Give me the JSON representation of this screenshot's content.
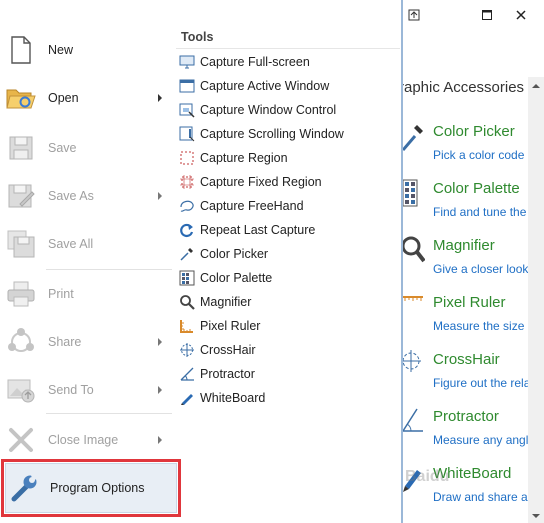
{
  "file_menu": {
    "items": [
      {
        "label": "New",
        "icon": "new-document-icon",
        "enabled": true,
        "submenu": false
      },
      {
        "label": "Open",
        "icon": "open-folder-icon",
        "enabled": true,
        "submenu": true
      },
      {
        "label": "Save",
        "icon": "save-icon",
        "enabled": false,
        "submenu": false
      },
      {
        "label": "Save As",
        "icon": "save-as-icon",
        "enabled": false,
        "submenu": true
      },
      {
        "label": "Save All",
        "icon": "save-all-icon",
        "enabled": false,
        "submenu": false
      },
      {
        "label": "Print",
        "icon": "printer-icon",
        "enabled": false,
        "submenu": false
      },
      {
        "label": "Share",
        "icon": "share-icon",
        "enabled": false,
        "submenu": true
      },
      {
        "label": "Send To",
        "icon": "send-to-icon",
        "enabled": false,
        "submenu": true
      },
      {
        "label": "Close Image",
        "icon": "close-icon",
        "enabled": false,
        "submenu": true
      }
    ],
    "program_options": {
      "label": "Program Options",
      "icon": "wrench-icon",
      "enabled": true
    }
  },
  "tools": {
    "header": "Tools",
    "items": [
      {
        "label": "Capture Full-screen",
        "icon": "monitor-icon"
      },
      {
        "label": "Capture Active Window",
        "icon": "window-icon"
      },
      {
        "label": "Capture Window Control",
        "icon": "window-control-icon"
      },
      {
        "label": "Capture Scrolling Window",
        "icon": "scrolling-window-icon"
      },
      {
        "label": "Capture Region",
        "icon": "region-icon"
      },
      {
        "label": "Capture Fixed Region",
        "icon": "fixed-region-icon"
      },
      {
        "label": "Capture FreeHand",
        "icon": "freehand-icon"
      },
      {
        "label": "Repeat Last Capture",
        "icon": "repeat-icon"
      },
      {
        "label": "Color Picker",
        "icon": "eyedropper-icon"
      },
      {
        "label": "Color Palette",
        "icon": "palette-icon"
      },
      {
        "label": "Magnifier",
        "icon": "magnifier-icon"
      },
      {
        "label": "Pixel Ruler",
        "icon": "ruler-icon"
      },
      {
        "label": "CrossHair",
        "icon": "crosshair-icon"
      },
      {
        "label": "Protractor",
        "icon": "protractor-icon"
      },
      {
        "label": "WhiteBoard",
        "icon": "whiteboard-pen-icon"
      }
    ]
  },
  "accessories": {
    "title": "raphic Accessories",
    "items": [
      {
        "name": "Color Picker",
        "desc": "Pick a color code",
        "icon": "eyedropper-icon"
      },
      {
        "name": "Color Palette",
        "desc": "Find and tune the",
        "icon": "palette-icon"
      },
      {
        "name": "Magnifier",
        "desc": "Give a closer look",
        "icon": "magnifier-icon"
      },
      {
        "name": "Pixel Ruler",
        "desc": "Measure the size o",
        "icon": "ruler-icon"
      },
      {
        "name": "CrossHair",
        "desc": "Figure out the rela",
        "icon": "crosshair-icon"
      },
      {
        "name": "Protractor",
        "desc": "Measure any angl",
        "icon": "protractor-icon"
      },
      {
        "name": "WhiteBoard",
        "desc": "Draw and share ar",
        "icon": "whiteboard-pen-icon"
      }
    ]
  },
  "window_controls": {
    "pin": "pin-icon",
    "maximize": "maximize-icon",
    "close": "close-icon"
  },
  "watermark": "Baidu",
  "colors": {
    "accent_green": "#2f8a2f",
    "link_blue": "#1f6fc5",
    "highlight_red": "#e0363c",
    "selection_bg": "#e8eef5"
  }
}
